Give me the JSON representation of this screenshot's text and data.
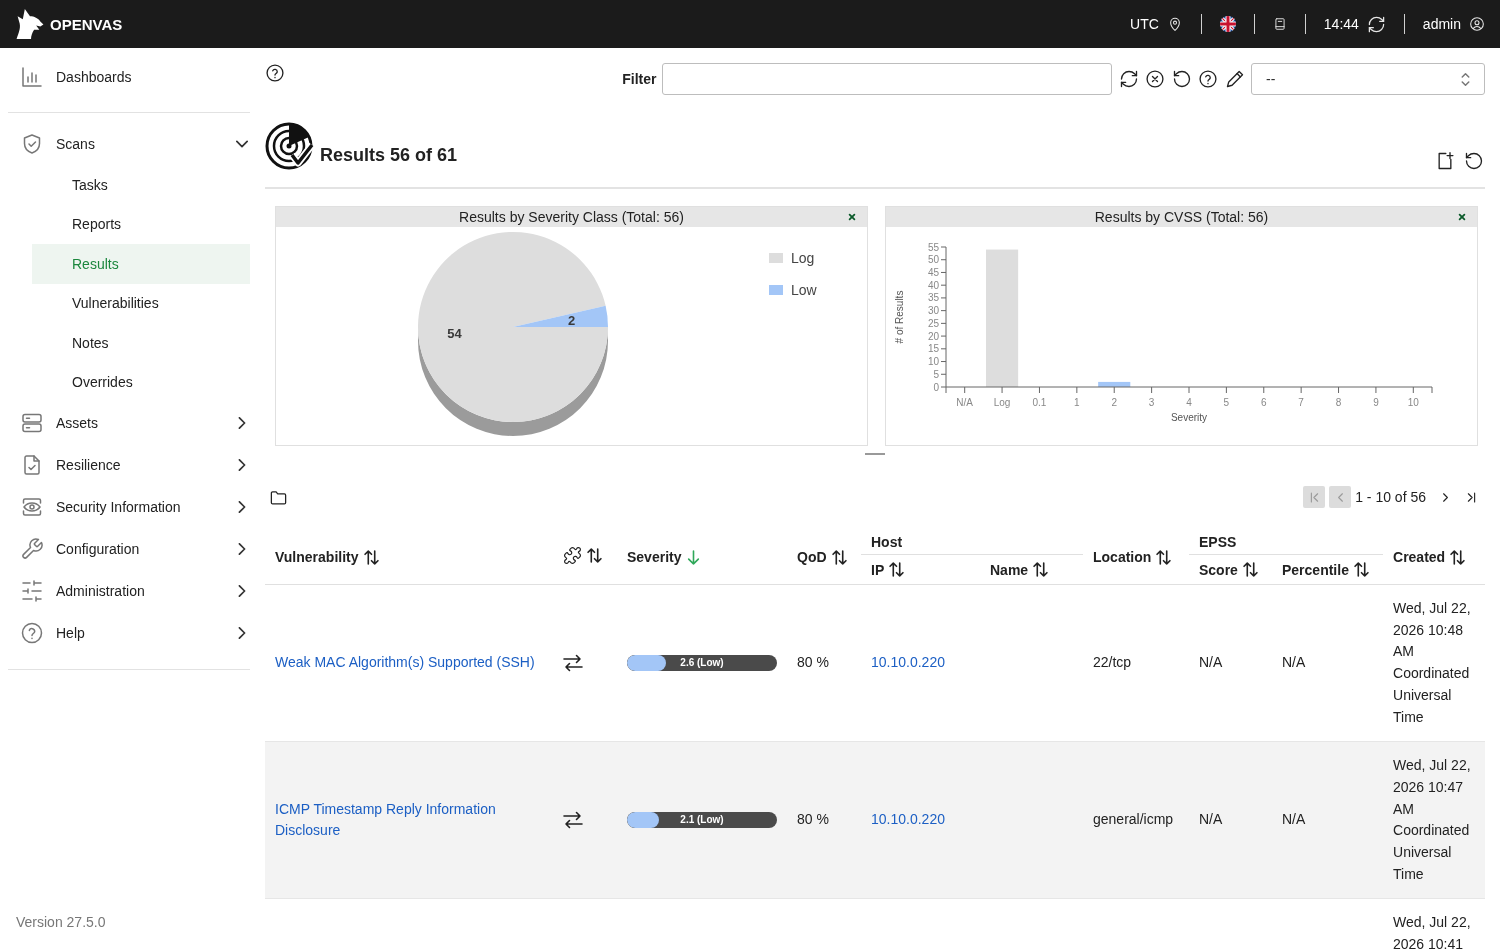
{
  "header": {
    "logo": "OPENVAS",
    "timezone": "UTC",
    "time": "14:44",
    "user": "admin"
  },
  "sidebar": {
    "sections": [
      {
        "items": [
          {
            "label": "Dashboards",
            "kind": "link",
            "selected": false
          }
        ]
      },
      {
        "items": [
          {
            "label": "Scans",
            "kind": "menu",
            "expanded": true,
            "children": [
              {
                "label": "Tasks",
                "selected": false
              },
              {
                "label": "Reports",
                "selected": false
              },
              {
                "label": "Results",
                "selected": true
              },
              {
                "label": "Vulnerabilities",
                "selected": false
              },
              {
                "label": "Notes",
                "selected": false
              },
              {
                "label": "Overrides",
                "selected": false
              }
            ]
          },
          {
            "label": "Assets",
            "kind": "menu",
            "expanded": false
          },
          {
            "label": "Resilience",
            "kind": "menu",
            "expanded": false
          },
          {
            "label": "Security Information",
            "kind": "menu",
            "expanded": false
          },
          {
            "label": "Configuration",
            "kind": "menu",
            "expanded": false
          },
          {
            "label": "Administration",
            "kind": "menu",
            "expanded": false
          },
          {
            "label": "Help",
            "kind": "menu",
            "expanded": false
          }
        ]
      }
    ],
    "version": "Version 27.5.0"
  },
  "filter": {
    "label": "Filter",
    "select_value": "--"
  },
  "page_title": "Results 56 of 61",
  "dashboard": {
    "charts": [
      {
        "slices": [
          {
            "color": "#dddddd"
          },
          {
            "color": "#a3c6f7"
          }
        ],
        "chart_data": {
          "type": "pie",
          "title": "Results by Severity Class (Total: 56)",
          "categories": [
            "Log",
            "Low"
          ],
          "values": [
            54,
            2
          ],
          "data_labels": true,
          "legend": "right"
        }
      },
      {
        "chart_data": {
          "type": "bar",
          "title": "Results by CVSS (Total: 56)",
          "xlabel": "Severity",
          "ylabel": "# of Results",
          "categories": [
            "N/A",
            "Log",
            "0.1",
            "1",
            "2",
            "3",
            "4",
            "5",
            "6",
            "7",
            "8",
            "9",
            "10"
          ],
          "series": [
            {
              "color": "#dddddd",
              "values": [
                0,
                54,
                0,
                0,
                0,
                0,
                0,
                0,
                0,
                0,
                0,
                0,
                0
              ]
            },
            {
              "color": "#a3c6f7",
              "values": [
                0,
                0,
                0,
                0,
                2,
                0,
                0,
                0,
                0,
                0,
                0,
                0,
                0
              ]
            }
          ],
          "stacked": true,
          "ylim": [
            0,
            55
          ],
          "yticks": [
            0,
            5,
            10,
            15,
            20,
            25,
            30,
            35,
            40,
            45,
            50,
            55
          ]
        }
      }
    ]
  },
  "pagination": {
    "first": {
      "disabled": true
    },
    "previous": {
      "disabled": true
    },
    "range": "1 - 10 of 56",
    "next": {
      "disabled": false
    },
    "last": {
      "disabled": false
    }
  },
  "table": {
    "columns": [
      {
        "kind": "text",
        "label": "Vulnerability",
        "sorted": false
      },
      {
        "kind": "icon",
        "sorted": false
      },
      {
        "kind": "text",
        "label": "Severity",
        "sorted": true
      },
      {
        "kind": "text",
        "label": "QoD",
        "sorted": false
      },
      {
        "kind": "group",
        "label": "Host",
        "children": [
          {
            "label": "IP",
            "sorted": false
          },
          {
            "label": "Name",
            "sorted": false
          }
        ]
      },
      {
        "kind": "text",
        "label": "Location",
        "sorted": false
      },
      {
        "kind": "group",
        "label": "EPSS",
        "children": [
          {
            "label": "Score",
            "sorted": false
          },
          {
            "label": "Percentile",
            "sorted": false
          }
        ]
      },
      {
        "kind": "text",
        "label": "Created",
        "sorted": false
      }
    ],
    "rows": [
      {
        "vulnerability": "Weak MAC Algorithm(s) Supported (SSH)",
        "severity": {
          "label": "2.6 (Low)",
          "level": 0.26
        },
        "qod": "80 %",
        "ip": "10.10.0.220",
        "location": "22/tcp",
        "epss_score": "N/A",
        "epss_percentile": "N/A",
        "created": "Wed, Jul 22, 2026 10:48 AM Coordinated Universal Time"
      },
      {
        "vulnerability": "ICMP Timestamp Reply Information Disclosure",
        "severity": {
          "label": "2.1 (Low)",
          "level": 0.21
        },
        "qod": "80 %",
        "ip": "10.10.0.220",
        "location": "general/icmp",
        "epss_score": "N/A",
        "epss_percentile": "N/A",
        "created": "Wed, Jul 22, 2026 10:47 AM Coordinated Universal Time"
      },
      {
        "created": "Wed, Jul 22, 2026 10:41"
      }
    ]
  }
}
